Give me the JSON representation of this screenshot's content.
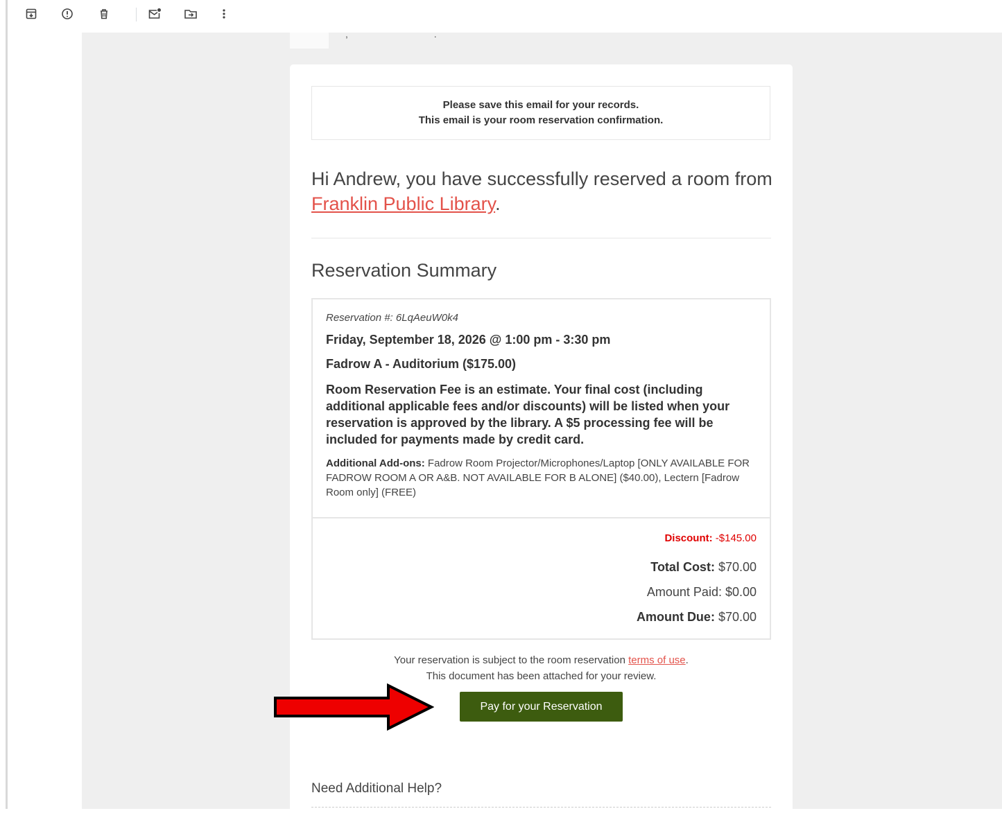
{
  "toolbar": {
    "icons": [
      "archive-icon",
      "report-spam-icon",
      "delete-icon",
      "mark-unread-icon",
      "move-to-icon",
      "more-options-icon"
    ]
  },
  "notice": {
    "line1": "Please save this email for your records.",
    "line2": "This email is your room reservation confirmation."
  },
  "greeting": {
    "text": "Hi Andrew, you have successfully reserved a room from ",
    "library_link": "Franklin Public Library",
    "end": "."
  },
  "summary": {
    "title": "Reservation Summary",
    "reservation_number": "Reservation #: 6LqAeuW0k4",
    "date_time": "Friday, September 18, 2026 @ 1:00 pm - 3:30 pm",
    "room": "Fadrow A - Auditorium ($175.00)",
    "fee_note": "Room Reservation Fee is an estimate. Your final cost (including additional applicable fees and/or discounts) will be listed when your reservation is approved by the library. A $5 processing fee will be included for payments made by credit card.",
    "addons_label": "Additional Add-ons:",
    "addons_text": " Fadrow Room Projector/Microphones/Laptop [ONLY AVAILABLE FOR FADROW ROOM A OR A&B. NOT AVAILABLE FOR B ALONE] ($40.00), Lectern [Fadrow Room only] (FREE)"
  },
  "costs": {
    "discount_label": "Discount:",
    "discount_value": " -$145.00",
    "total_label": "Total Cost:",
    "total_value": " $70.00",
    "paid_text": "Amount Paid: $0.00",
    "due_label": "Amount Due:",
    "due_value": " $70.00"
  },
  "terms": {
    "text": "Your reservation is subject to the room reservation ",
    "link": "terms of use",
    "end": ".",
    "line2": "This document has been attached for your review."
  },
  "pay_button": {
    "label": "Pay for your Reservation"
  },
  "help": {
    "title": "Need Additional Help?"
  },
  "colors": {
    "accent_link": "#e3524a",
    "button_green": "#3d5c0f",
    "discount_red": "#e00000",
    "arrow_red": "#ee0000",
    "canvas_gray": "#efefef"
  }
}
